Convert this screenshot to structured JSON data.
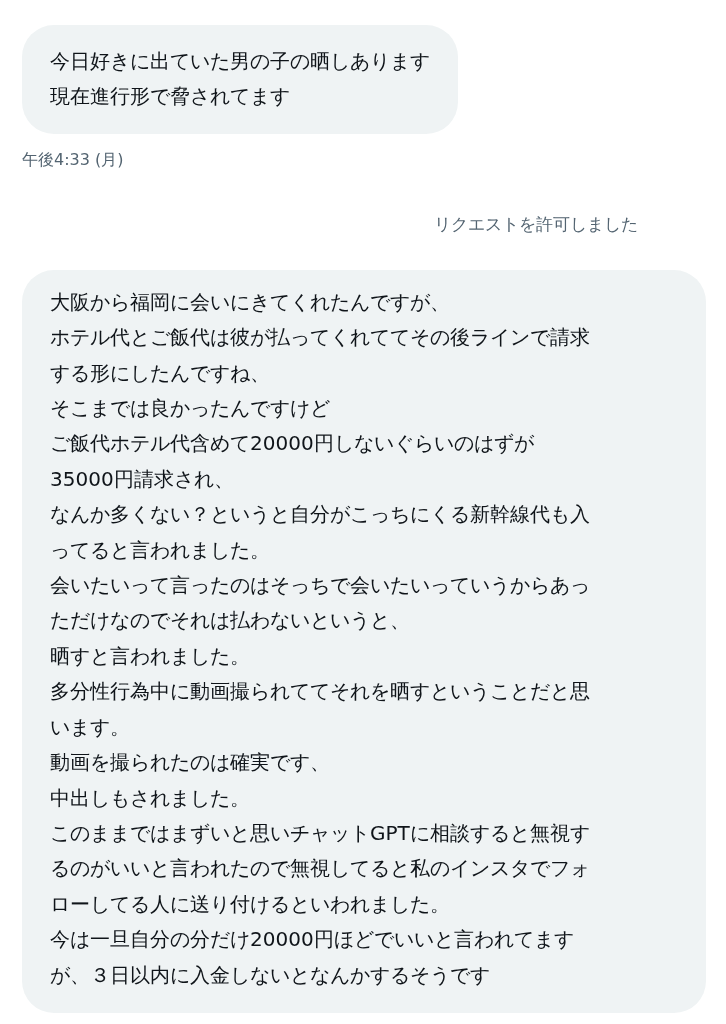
{
  "conversation": [
    {
      "kind": "message",
      "lines": [
        "今日好きに出ていた男の子の晒しあります",
        "現在進行形で脅されてます"
      ]
    },
    {
      "kind": "timestamp",
      "text": "午後4:33 (月)"
    },
    {
      "kind": "notice",
      "text": "リクエストを許可しました"
    },
    {
      "kind": "message",
      "lines": [
        "大阪から福岡に会いにきてくれたんですが、",
        "ホテル代とご飯代は彼が払ってくれててその後ラインで請求",
        "する形にしたんですね、",
        "そこまでは良かったんですけど",
        "ご飯代ホテル代含めて20000円しないぐらいのはずが",
        "35000円請求され、",
        "なんか多くない？というと自分がこっちにくる新幹線代も入",
        "ってると言われました。",
        "会いたいって言ったのはそっちで会いたいっていうからあっ",
        "ただけなのでそれは払わないというと、",
        "晒すと言われました。",
        "多分性行為中に動画撮られててそれを晒すということだと思",
        "います。",
        "動画を撮られたのは確実です、",
        "中出しもされました。",
        "このままではまずいと思いチャットGPTに相談すると無視す",
        "るのがいいと言われたので無視してると私のインスタでフォ",
        "ローしてる人に送り付けるといわれました。",
        "今は一旦自分の分だけ20000円ほどでいいと言われてます",
        "が、３日以内に入金しないとなんかするそうです"
      ]
    }
  ]
}
